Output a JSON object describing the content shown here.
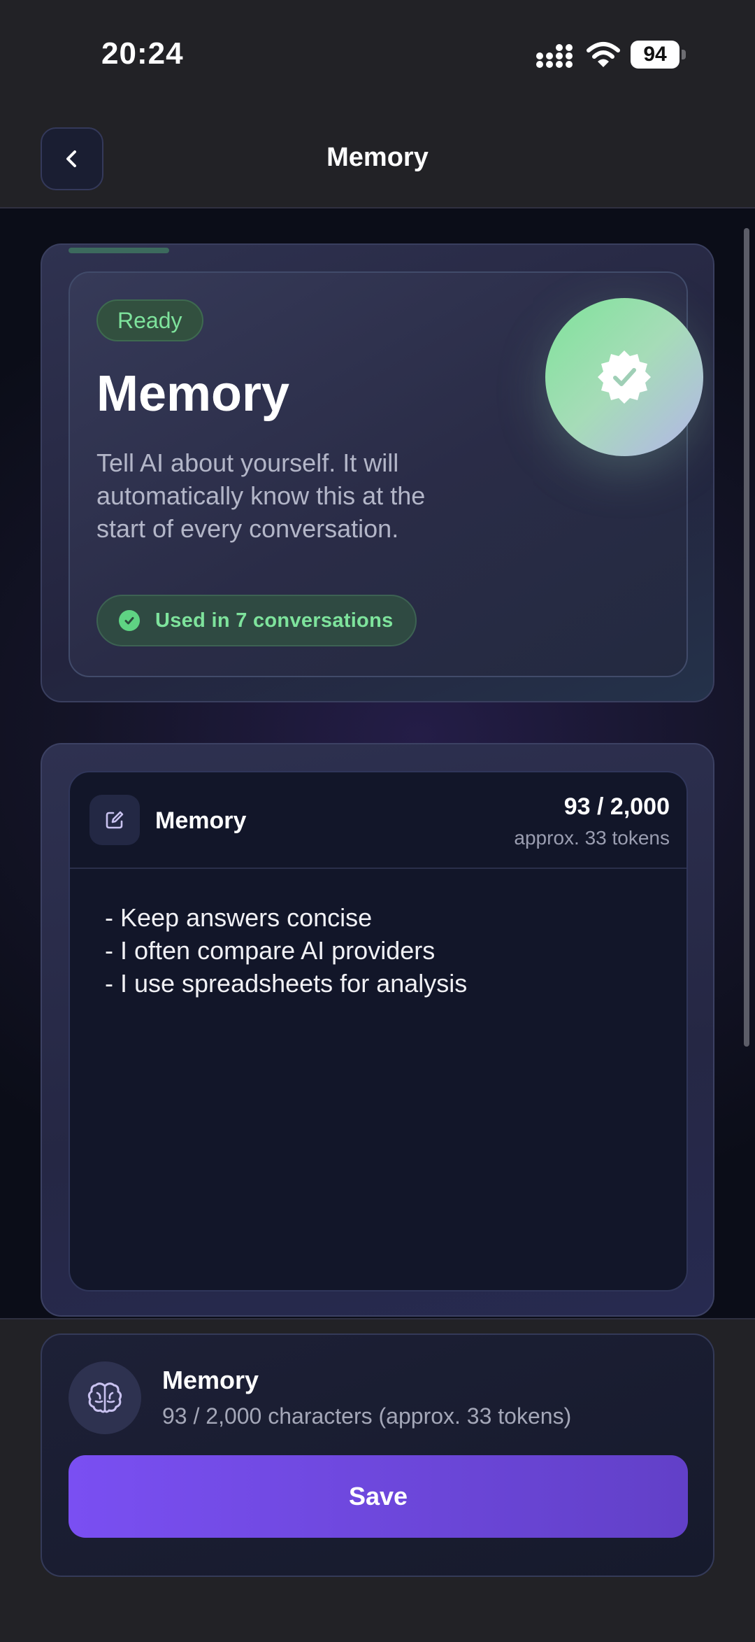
{
  "status_bar": {
    "time": "20:24",
    "battery": "94",
    "icons": [
      "signal-icon",
      "wifi-icon",
      "battery-icon"
    ]
  },
  "nav": {
    "title": "Memory",
    "back_icon": "chevron-left-icon"
  },
  "hero": {
    "badge": "Ready",
    "title": "Memory",
    "description": "Tell AI about yourself. It will automatically know this at the start of every conversation.",
    "usage": "Used in 7 conversations",
    "icons": [
      "verified-badge-icon",
      "check-circle-icon"
    ],
    "colors": {
      "accent_green": "#7ee39c"
    }
  },
  "editor": {
    "label": "Memory",
    "count": "93 / 2,000",
    "tokens": "approx. 33 tokens",
    "content": "- Keep answers concise\n- I often compare AI providers\n- I use spreadsheets for analysis",
    "icon": "edit-icon"
  },
  "footer": {
    "title": "Memory",
    "subtitle": "93 / 2,000 characters (approx. 33 tokens)",
    "save_label": "Save",
    "icon": "brain-icon",
    "colors": {
      "save_button": "#7a4ff2"
    }
  }
}
